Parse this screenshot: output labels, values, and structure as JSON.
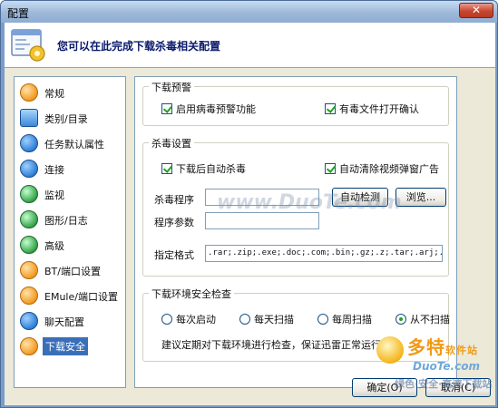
{
  "window": {
    "title": "配置",
    "close_symbol": "✕"
  },
  "header": {
    "text": "您可以在此完成下载杀毒相关配置"
  },
  "sidebar": {
    "items": [
      {
        "label": "常规",
        "icon": "user-icon"
      },
      {
        "label": "类别/目录",
        "icon": "folder-icon"
      },
      {
        "label": "任务默认属性",
        "icon": "star-icon"
      },
      {
        "label": "连接",
        "icon": "connect-icon"
      },
      {
        "label": "监视",
        "icon": "monitor-icon"
      },
      {
        "label": "图形/日志",
        "icon": "chart-icon"
      },
      {
        "label": "高级",
        "icon": "gear-icon"
      },
      {
        "label": "BT/端口设置",
        "icon": "bt-icon"
      },
      {
        "label": "EMule/端口设置",
        "icon": "emule-icon"
      },
      {
        "label": "聊天配置",
        "icon": "chat-icon"
      },
      {
        "label": "下载安全",
        "icon": "shield-icon",
        "active": true
      }
    ]
  },
  "warning_group": {
    "title": "下载预警",
    "enable_warning": "启用病毒预警功能",
    "confirm_open": "有毒文件打开确认"
  },
  "antivirus_group": {
    "title": "杀毒设置",
    "auto_scan": "下载后自动杀毒",
    "auto_clear_ads": "自动清除视频弹窗广告",
    "program_label": "杀毒程序",
    "program_value": "",
    "params_label": "程序参数",
    "params_value": "",
    "auto_detect_btn": "自动检测",
    "browse_btn": "浏览...",
    "formats_label": "指定格式",
    "formats_value": ".rar;.zip;.exe;.doc;.com;.bin;.gz;.z;.tar;.arj;.l"
  },
  "env_group": {
    "title": "下载环境安全检查",
    "options": [
      "每次启动",
      "每天扫描",
      "每周扫描",
      "从不扫描"
    ],
    "selected": "从不扫描",
    "advice": "建议定期对下载环境进行检查，保证迅雷正常运行"
  },
  "footer": {
    "ok_btn": "确定(O)",
    "cancel_btn": "取消(C)"
  },
  "watermarks": {
    "site_center": "www.DuoTe.com",
    "logo_cn": "多特",
    "logo_cn_suffix": "软件站",
    "logo_en": "DuoTe.com",
    "logo_tagline": "绿色·安全·高速下载站"
  }
}
